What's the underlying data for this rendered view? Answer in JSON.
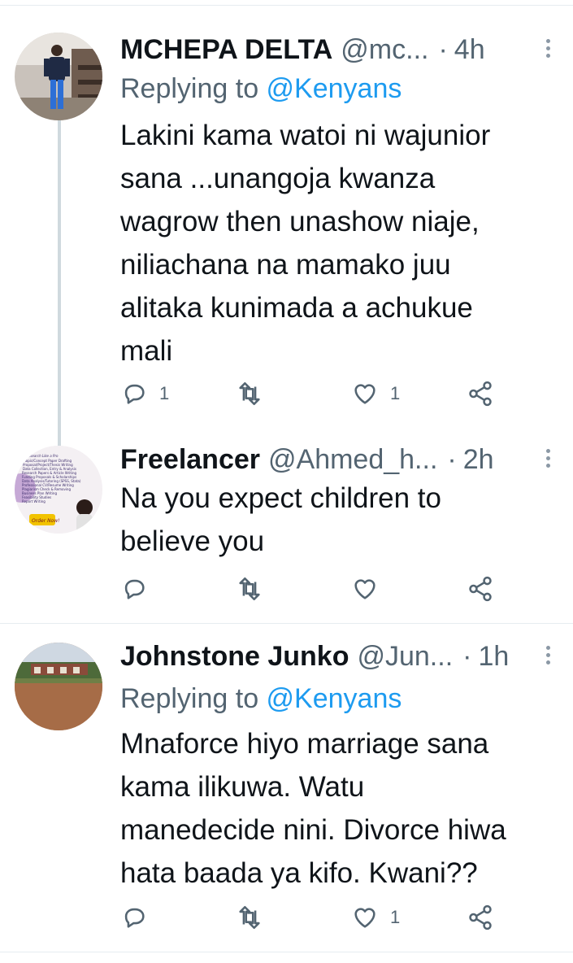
{
  "tweets": [
    {
      "name": "MCHEPA DELTA",
      "handle": "@mc...",
      "time": "4h",
      "replying_prefix": "Replying to ",
      "replying_to": "@Kenyans",
      "lines": [
        "Lakini kama watoi ni wajunior",
        "sana ...unangoja kwanza",
        "wagrow then unashow niaje,",
        "niliachana na mamako juu",
        "alitaka kunimada a achukue",
        "mali"
      ],
      "reply_count": "1",
      "retweet_count": "",
      "like_count": "1",
      "icons": {
        "reply": "reply-icon",
        "retweet": "retweet-icon",
        "like": "heart-icon",
        "share": "share-icon"
      }
    },
    {
      "name": "Freelancer",
      "handle": "@Ahmed_h...",
      "time": "2h",
      "lines": [
        "Na you expect children to",
        "believe you"
      ],
      "reply_count": "",
      "retweet_count": "",
      "like_count": "",
      "avatar_text": [
        "Research Like a Pro",
        "Topic/Concept Paper Drafting",
        "Proposal/Project/Thesis Writing",
        "Data Collection, Entry & Analysis",
        "Research Papers & Article Writing",
        "Funding Proposals & Scholarships",
        "Data Analysis/Tutoring (SPSS, Stata)",
        "Professional CV/Resume Writing",
        "Plagiarism Check & Removing",
        "Business Plan Writing",
        "Feasibility Studies",
        "Report Writing",
        "Order Now!"
      ],
      "icons": {
        "reply": "reply-icon",
        "retweet": "retweet-icon",
        "like": "heart-icon",
        "share": "share-icon"
      }
    },
    {
      "name": "Johnstone Junko",
      "handle": "@Jun...",
      "time": "1h",
      "replying_prefix": "Replying to ",
      "replying_to": "@Kenyans",
      "lines": [
        "Mnaforce hiyo marriage sana",
        "kama ilikuwa. Watu",
        "manedecide nini. Divorce hiwa",
        "hata baada ya kifo. Kwani??"
      ],
      "reply_count": "",
      "retweet_count": "",
      "like_count": "1",
      "icons": {
        "reply": "reply-icon",
        "retweet": "retweet-icon",
        "like": "heart-icon",
        "share": "share-icon"
      }
    }
  ],
  "dot": "·",
  "colors": {
    "text": "#0f1419",
    "secondary": "#536471",
    "link": "#1d9bf0",
    "divider": "#e6ecf0"
  }
}
